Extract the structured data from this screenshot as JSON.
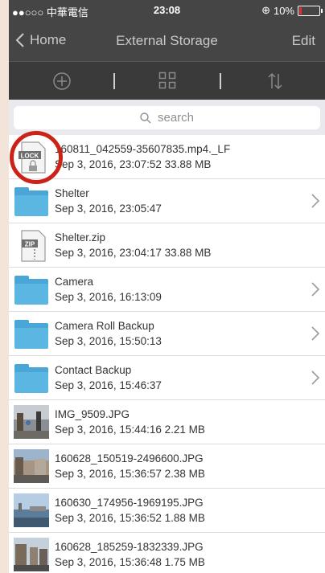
{
  "status_bar": {
    "carrier": "●●○○○ 中華電信",
    "time": "23:08",
    "battery": "10%"
  },
  "nav": {
    "back_label": "Home",
    "title": "External Storage",
    "edit_label": "Edit"
  },
  "search": {
    "placeholder": "search"
  },
  "files": [
    {
      "name": "160811_042559-35607835.mp4._LF",
      "meta": "Sep 3, 2016, 23:07:52  33.88 MB",
      "icon": "lock-file-icon"
    },
    {
      "name": "Shelter",
      "meta": "Sep 3, 2016, 23:05:47",
      "icon": "folder-icon"
    },
    {
      "name": "Shelter.zip",
      "meta": "Sep 3, 2016, 23:04:17  33.88 MB",
      "icon": "zip-file-icon"
    },
    {
      "name": "Camera",
      "meta": "Sep 3, 2016, 16:13:09",
      "icon": "folder-icon"
    },
    {
      "name": "Camera Roll Backup",
      "meta": "Sep 3, 2016, 15:50:13",
      "icon": "folder-icon"
    },
    {
      "name": "Contact Backup",
      "meta": "Sep 3, 2016, 15:46:37",
      "icon": "folder-icon"
    },
    {
      "name": "IMG_9509.JPG",
      "meta": "Sep 3, 2016, 15:44:16  2.21 MB",
      "icon": "photo-thumbnail"
    },
    {
      "name": "160628_150519-2496600.JPG",
      "meta": "Sep 3, 2016, 15:36:57  2.38 MB",
      "icon": "photo-thumbnail"
    },
    {
      "name": "160630_174956-1969195.JPG",
      "meta": "Sep 3, 2016, 15:36:52  1.88 MB",
      "icon": "photo-thumbnail"
    },
    {
      "name": "160628_185259-1832339.JPG",
      "meta": "Sep 3, 2016, 15:36:48  1.75 MB",
      "icon": "photo-thumbnail"
    }
  ],
  "icons": {
    "lock_label": "LOCK",
    "zip_label": "ZIP"
  },
  "colors": {
    "bar": "#454545",
    "folder": "#4aa6d6",
    "highlight_circle": "#cc2218"
  }
}
